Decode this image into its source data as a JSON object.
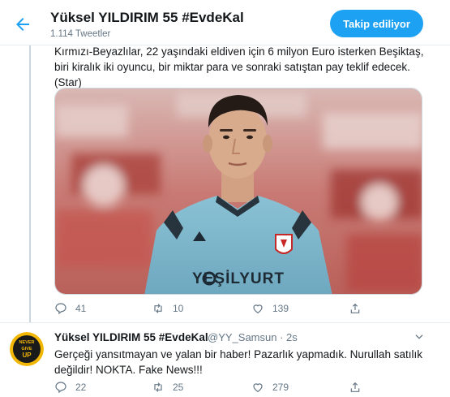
{
  "header": {
    "title": "Yüksel YILDIRIM 55 #EvdeKal",
    "subtitle": "1.114 Tweetler",
    "follow_label": "Takip ediliyor"
  },
  "tweet": {
    "text_lines": [
      "Kırmızı-Beyazlılar, 22 yaşındaki eldiven için 6 milyon Euro isterken Beşiktaş,",
      "biri kiralık iki oyuncu, bir miktar para ve sonraki satıştan pay teklif edecek.",
      "(Star)"
    ],
    "media": {
      "jersey_sponsor": "YEŞİLYURT"
    },
    "stats": {
      "replies": "41",
      "retweets": "10",
      "likes": "139"
    }
  },
  "reply": {
    "avatar_text": [
      "NEVER",
      "GIVE",
      "UP"
    ],
    "name": "Yüksel YILDIRIM 55 #EvdeKal",
    "handle": "@YY_Samsun · 2s",
    "text_lines": [
      "Gerçeği yansıtmayan ve yalan bir haber! Pazarlık yapmadık. Nurullah satılık",
      "değildir! NOKTA. Fake News!!!"
    ],
    "stats": {
      "replies": "22",
      "retweets": "25",
      "likes": "279"
    }
  },
  "colors": {
    "accent": "#1da1f2",
    "text_primary": "#14171a",
    "text_secondary": "#657786",
    "border": "#e6ecf0",
    "jersey": "#7fb5c9"
  }
}
